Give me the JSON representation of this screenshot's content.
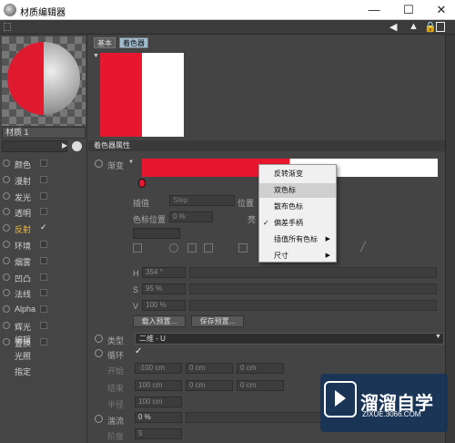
{
  "window": {
    "title": "材质编辑器",
    "controls": {
      "minimize": "—",
      "maximize": "☐",
      "close": "✕"
    }
  },
  "material": {
    "name": "材质 1"
  },
  "channels": [
    {
      "label": "颜色",
      "checked": false
    },
    {
      "label": "漫射",
      "checked": false
    },
    {
      "label": "发光",
      "checked": false
    },
    {
      "label": "透明",
      "checked": false
    },
    {
      "label": "反射",
      "checked": true,
      "active": true
    },
    {
      "label": "环境",
      "checked": false
    },
    {
      "label": "烟雾",
      "checked": false
    },
    {
      "label": "凹凸",
      "checked": false
    },
    {
      "label": "法线",
      "checked": false
    },
    {
      "label": "Alpha",
      "checked": false
    },
    {
      "label": "辉光",
      "checked": false
    },
    {
      "label": "置换",
      "checked": false
    }
  ],
  "extra_items": [
    "编辑",
    "光照",
    "指定"
  ],
  "tabs": [
    "基本",
    "着色器"
  ],
  "section": {
    "title": "着色器属性"
  },
  "gradient": {
    "label": "渐变",
    "left_color": "#e8172f",
    "right_color": "#ffffff"
  },
  "props": {
    "interp_label": "插值",
    "interp_value": "Step",
    "pos_label": "位置",
    "color_pos_label": "色标位置",
    "color_pos_value": "0 %",
    "bright_label": "亮",
    "h_label": "H",
    "h_value": "354 °",
    "s_label": "S",
    "s_value": "95 %",
    "v_label": "V",
    "v_value": "100 %",
    "load_btn": "载入预置...",
    "save_btn": "保存预置...",
    "type_label": "类型",
    "type_value": "二维 - U",
    "cycle_label": "循环",
    "start_label": "开始",
    "start_values": [
      "-100 cm",
      "0 cm",
      "0 cm"
    ],
    "end_label": "结束",
    "end_values": [
      "100 cm",
      "0 cm",
      "0 cm"
    ],
    "radius_label": "半径",
    "radius_value": "100 cm",
    "turb_label": "湍流",
    "turb_value": "0 %",
    "octave_label": "阶度",
    "octave_value": "5"
  },
  "context_menu": [
    {
      "label": "反转渐变"
    },
    {
      "label": "双色标",
      "highlighted": true
    },
    {
      "label": "散布色标"
    },
    {
      "label": "偏差手柄",
      "checked": true
    },
    {
      "label": "插值所有色标",
      "submenu": true
    },
    {
      "label": "尺寸",
      "submenu": true
    }
  ],
  "watermark": {
    "name": "溜溜自学",
    "url": "ZIXUE.3066.COM"
  }
}
